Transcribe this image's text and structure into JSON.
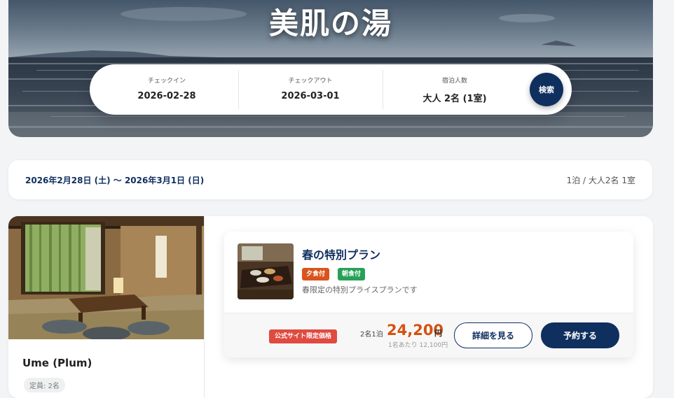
{
  "hero": {
    "title": "美肌の湯"
  },
  "search": {
    "checkin_label": "チェックイン",
    "checkin_value": "2026-02-28",
    "checkout_label": "チェックアウト",
    "checkout_value": "2026-03-01",
    "guests_label": "宿泊人数",
    "guests_value": "大人 2名 (1室)",
    "button_label": "検索"
  },
  "summary": {
    "date_range": "2026年2月28日 (土) 〜 2026年3月1日 (日)",
    "guests": "1泊 / 大人2名 1室"
  },
  "room": {
    "name": "Ume (Plum)",
    "capacity": "定員: 2名"
  },
  "plan": {
    "title": "春の特別プラン",
    "tags": [
      {
        "label": "夕食付",
        "color": "#d9541c"
      },
      {
        "label": "朝食付",
        "color": "#27a157"
      }
    ],
    "description": "春限定の特別プライスプランです",
    "official_badge": "公式サイト限定価格",
    "price_unit": "2名1泊",
    "price": "24,200",
    "currency": "円",
    "per_person": "1名あたり 12,100円",
    "detail_button": "詳細を見る",
    "book_button": "予約する"
  },
  "colors": {
    "primary": "#0f2f5e",
    "price": "#d4520f",
    "official_badge": "#e04a3f"
  }
}
